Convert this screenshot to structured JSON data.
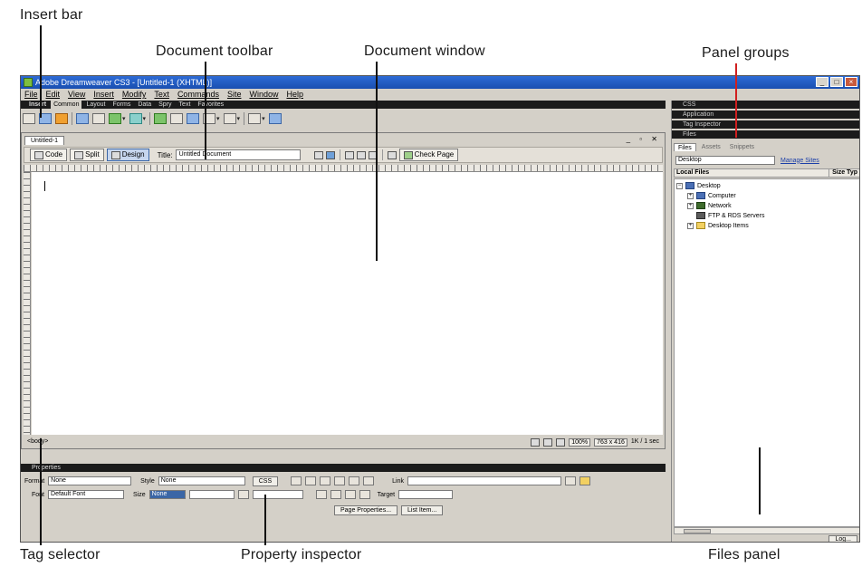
{
  "callouts": {
    "insert_bar": "Insert bar",
    "document_toolbar": "Document toolbar",
    "document_window": "Document window",
    "panel_groups": "Panel groups",
    "tag_selector": "Tag selector",
    "property_inspector": "Property inspector",
    "files_panel": "Files panel"
  },
  "app": {
    "title": "Adobe Dreamweaver CS3 - [Untitled-1 (XHTML)]",
    "menu": [
      "File",
      "Edit",
      "View",
      "Insert",
      "Modify",
      "Text",
      "Commands",
      "Site",
      "Window",
      "Help"
    ]
  },
  "insert_bar": {
    "header": "Insert",
    "tabs": [
      "Common",
      "Layout",
      "Forms",
      "Data",
      "Spry",
      "Text",
      "Favorites"
    ],
    "active_tab": "Common"
  },
  "document": {
    "tab": "Untitled-1",
    "controls": "_ ▫ ✕",
    "code_label": "Code",
    "split_label": "Split",
    "design_label": "Design",
    "title_label": "Title:",
    "title_value": "Untitled Document",
    "check_page_label": "Check Page",
    "tag_selector": "<body>",
    "zoom": "100%",
    "dimensions": "763 x 416",
    "size": "1K / 1 sec"
  },
  "properties": {
    "header": "Properties",
    "format_label": "Format",
    "format_value": "None",
    "style_label": "Style",
    "style_value": "None",
    "css_label": "CSS",
    "link_label": "Link",
    "font_label": "Font",
    "font_value": "Default Font",
    "size_label": "Size",
    "size_value": "None",
    "target_label": "Target",
    "page_properties_label": "Page Properties...",
    "list_item_label": "List Item..."
  },
  "panels": {
    "groups": [
      "CSS",
      "Application",
      "Tag Inspector",
      "Files"
    ],
    "files_tabs": [
      "Files",
      "Assets",
      "Snippets"
    ],
    "active_files_tab": "Files",
    "site_select": "Desktop",
    "manage_sites_label": "Manage Sites",
    "local_files_header": "Local Files",
    "size_header": "Size Typ",
    "tree": [
      {
        "label": "Desktop",
        "level": 0,
        "icon": "desktop-icon"
      },
      {
        "label": "Computer",
        "level": 1,
        "icon": "computer-icon"
      },
      {
        "label": "Network",
        "level": 1,
        "icon": "network-icon"
      },
      {
        "label": "FTP & RDS Servers",
        "level": 1,
        "icon": "ftp-icon"
      },
      {
        "label": "Desktop Items",
        "level": 1,
        "icon": "folder-icon"
      }
    ],
    "log_label": "Log..."
  }
}
